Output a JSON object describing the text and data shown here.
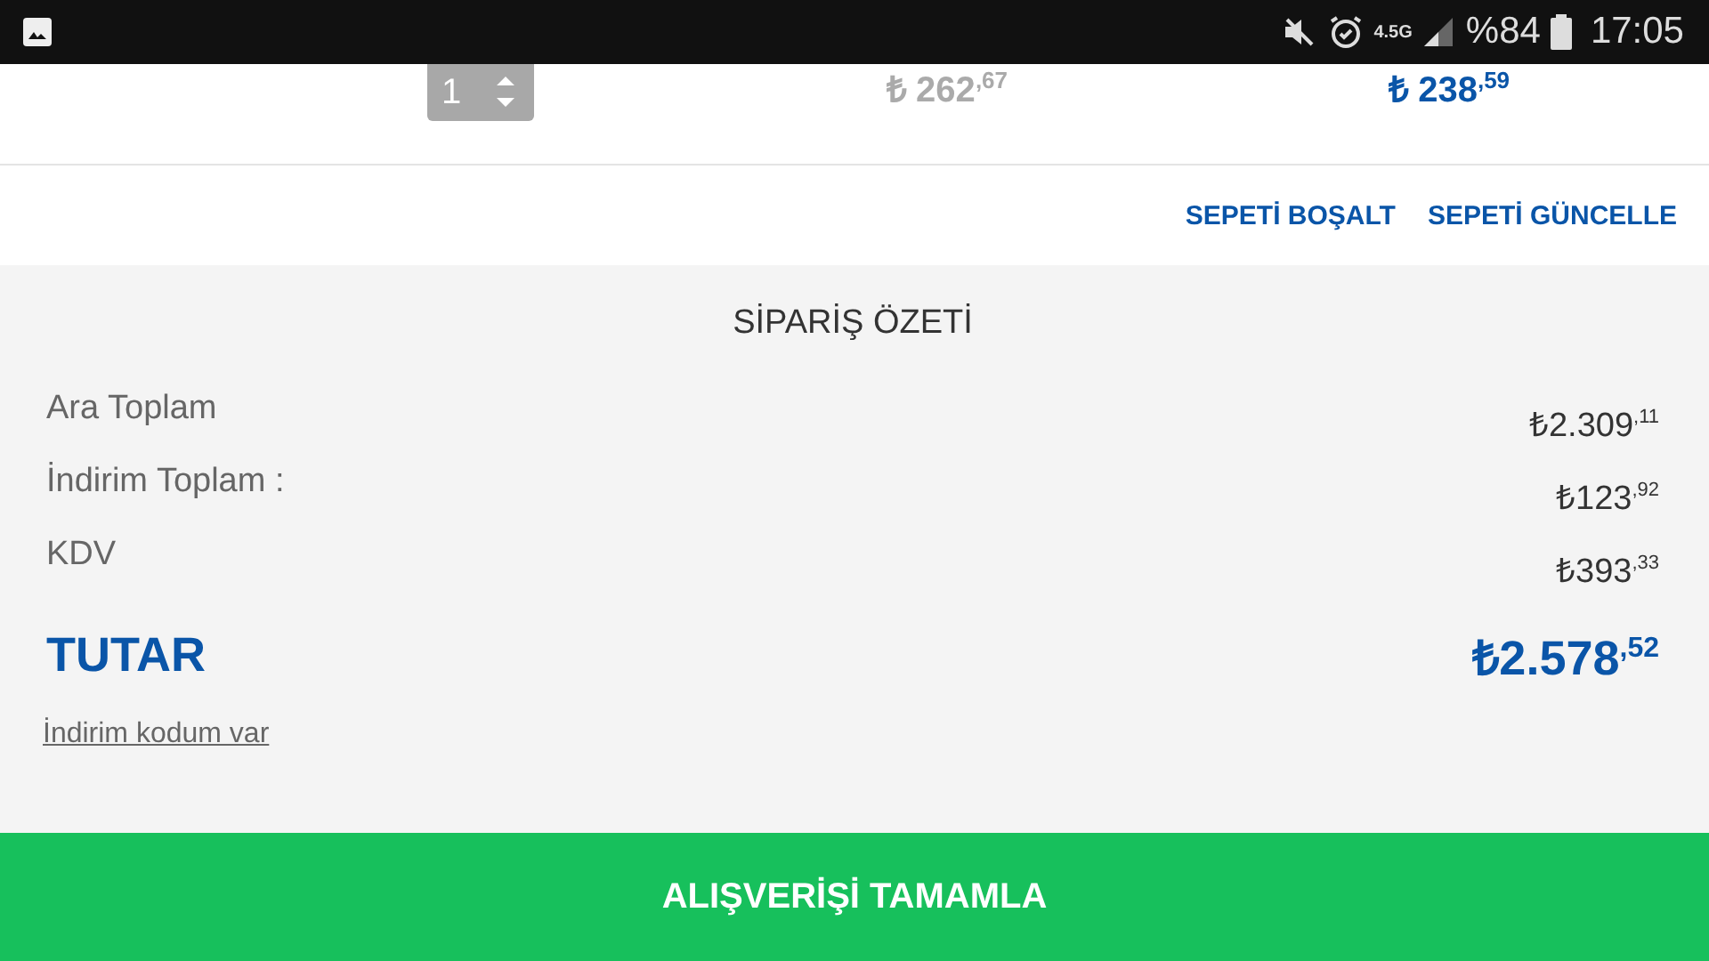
{
  "status_bar": {
    "network": "4.5G",
    "battery": "%84",
    "time": "17:05"
  },
  "cart_item": {
    "quantity": "1",
    "old_price": "₺ 262$^{,67}$",
    "price": "₺ 238$^{,59}$"
  },
  "cart_actions": [
    "SEPETİ BOŞALT",
    "SEPETİ GÜNCELLE"
  ],
  "summary": {
    "title": "SİPARİŞ ÖZETİ",
    "rows": [
      {
        "label": "Ara Toplam",
        "value": "₺2.309$^{,11}$"
      },
      {
        "label": "İndirim Toplam :",
        "value": "₺123$^{,92}$"
      },
      {
        "label": "KDV",
        "value": "₺393$^{,33}$"
      }
    ],
    "total_label": "TUTAR",
    "total_value": "₺2.578$^{,52}$",
    "coupon_link": "İndirim kodum var"
  },
  "checkout_button": "ALIŞVERİŞİ TAMAMLA"
}
